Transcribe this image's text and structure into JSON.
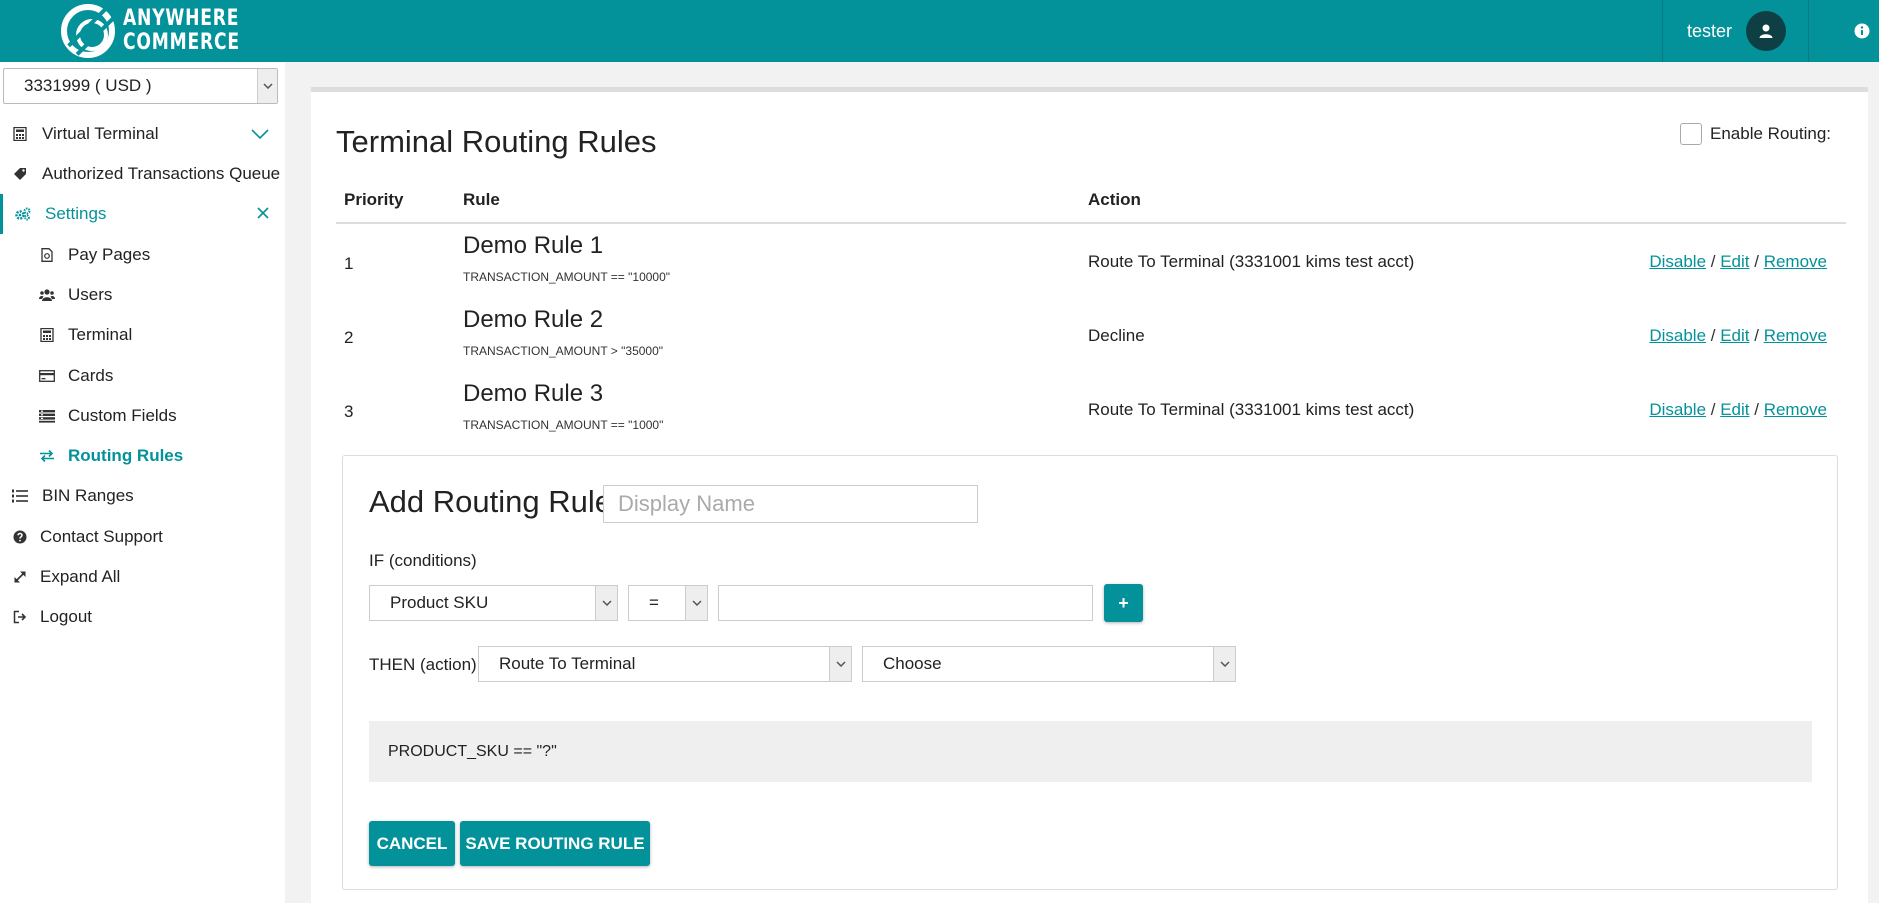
{
  "header": {
    "brand_line1": "ANYWHERE",
    "brand_line2": "COMMERCE",
    "username": "tester",
    "accent_color": "#04929a"
  },
  "sidebar": {
    "account_selector": "3331999 ( USD )",
    "items": [
      {
        "label": "Virtual Terminal",
        "icon": "calculator-icon"
      },
      {
        "label": "Authorized Transactions Queue",
        "icon": "tag-icon"
      },
      {
        "label": "Settings",
        "icon": "gears-icon"
      },
      {
        "label": "Pay Pages",
        "icon": "file-icon"
      },
      {
        "label": "Users",
        "icon": "users-icon"
      },
      {
        "label": "Terminal",
        "icon": "calculator-icon"
      },
      {
        "label": "Cards",
        "icon": "credit-card-icon"
      },
      {
        "label": "Custom Fields",
        "icon": "list-icon"
      },
      {
        "label": "Routing Rules",
        "icon": "exchange-icon"
      },
      {
        "label": "BIN Ranges",
        "icon": "list-ol-icon"
      },
      {
        "label": "Contact Support",
        "icon": "question-circle-icon"
      },
      {
        "label": "Expand All",
        "icon": "expand-icon"
      },
      {
        "label": "Logout",
        "icon": "sign-out-icon"
      }
    ]
  },
  "main": {
    "title": "Terminal Routing Rules",
    "enable_routing_label": "Enable Routing:",
    "table": {
      "headers": {
        "priority": "Priority",
        "rule": "Rule",
        "action": "Action"
      },
      "rows": [
        {
          "priority": "1",
          "name": "Demo Rule 1",
          "condition": "TRANSACTION_AMOUNT == \"10000\"",
          "action": "Route To Terminal (3331001 kims test acct)"
        },
        {
          "priority": "2",
          "name": "Demo Rule 2",
          "condition": "TRANSACTION_AMOUNT > \"35000\"",
          "action": "Decline"
        },
        {
          "priority": "3",
          "name": "Demo Rule 3",
          "condition": "TRANSACTION_AMOUNT == \"1000\"",
          "action": "Route To Terminal (3331001 kims test acct)"
        }
      ],
      "link_disable": "Disable",
      "link_edit": "Edit",
      "link_remove": "Remove",
      "link_separator": " / "
    },
    "add_form": {
      "title": "Add Routing Rule",
      "display_name_placeholder": "Display Name",
      "if_label": "IF (conditions)",
      "field_select": "Product SKU",
      "operator_select": "=",
      "value": "",
      "plus_label": "+",
      "then_label": "THEN (action)",
      "action_select": "Route To Terminal",
      "terminal_select": "Choose",
      "preview": "PRODUCT_SKU == \"?\"",
      "cancel_label": "CANCEL",
      "save_label": "SAVE ROUTING RULE"
    }
  }
}
